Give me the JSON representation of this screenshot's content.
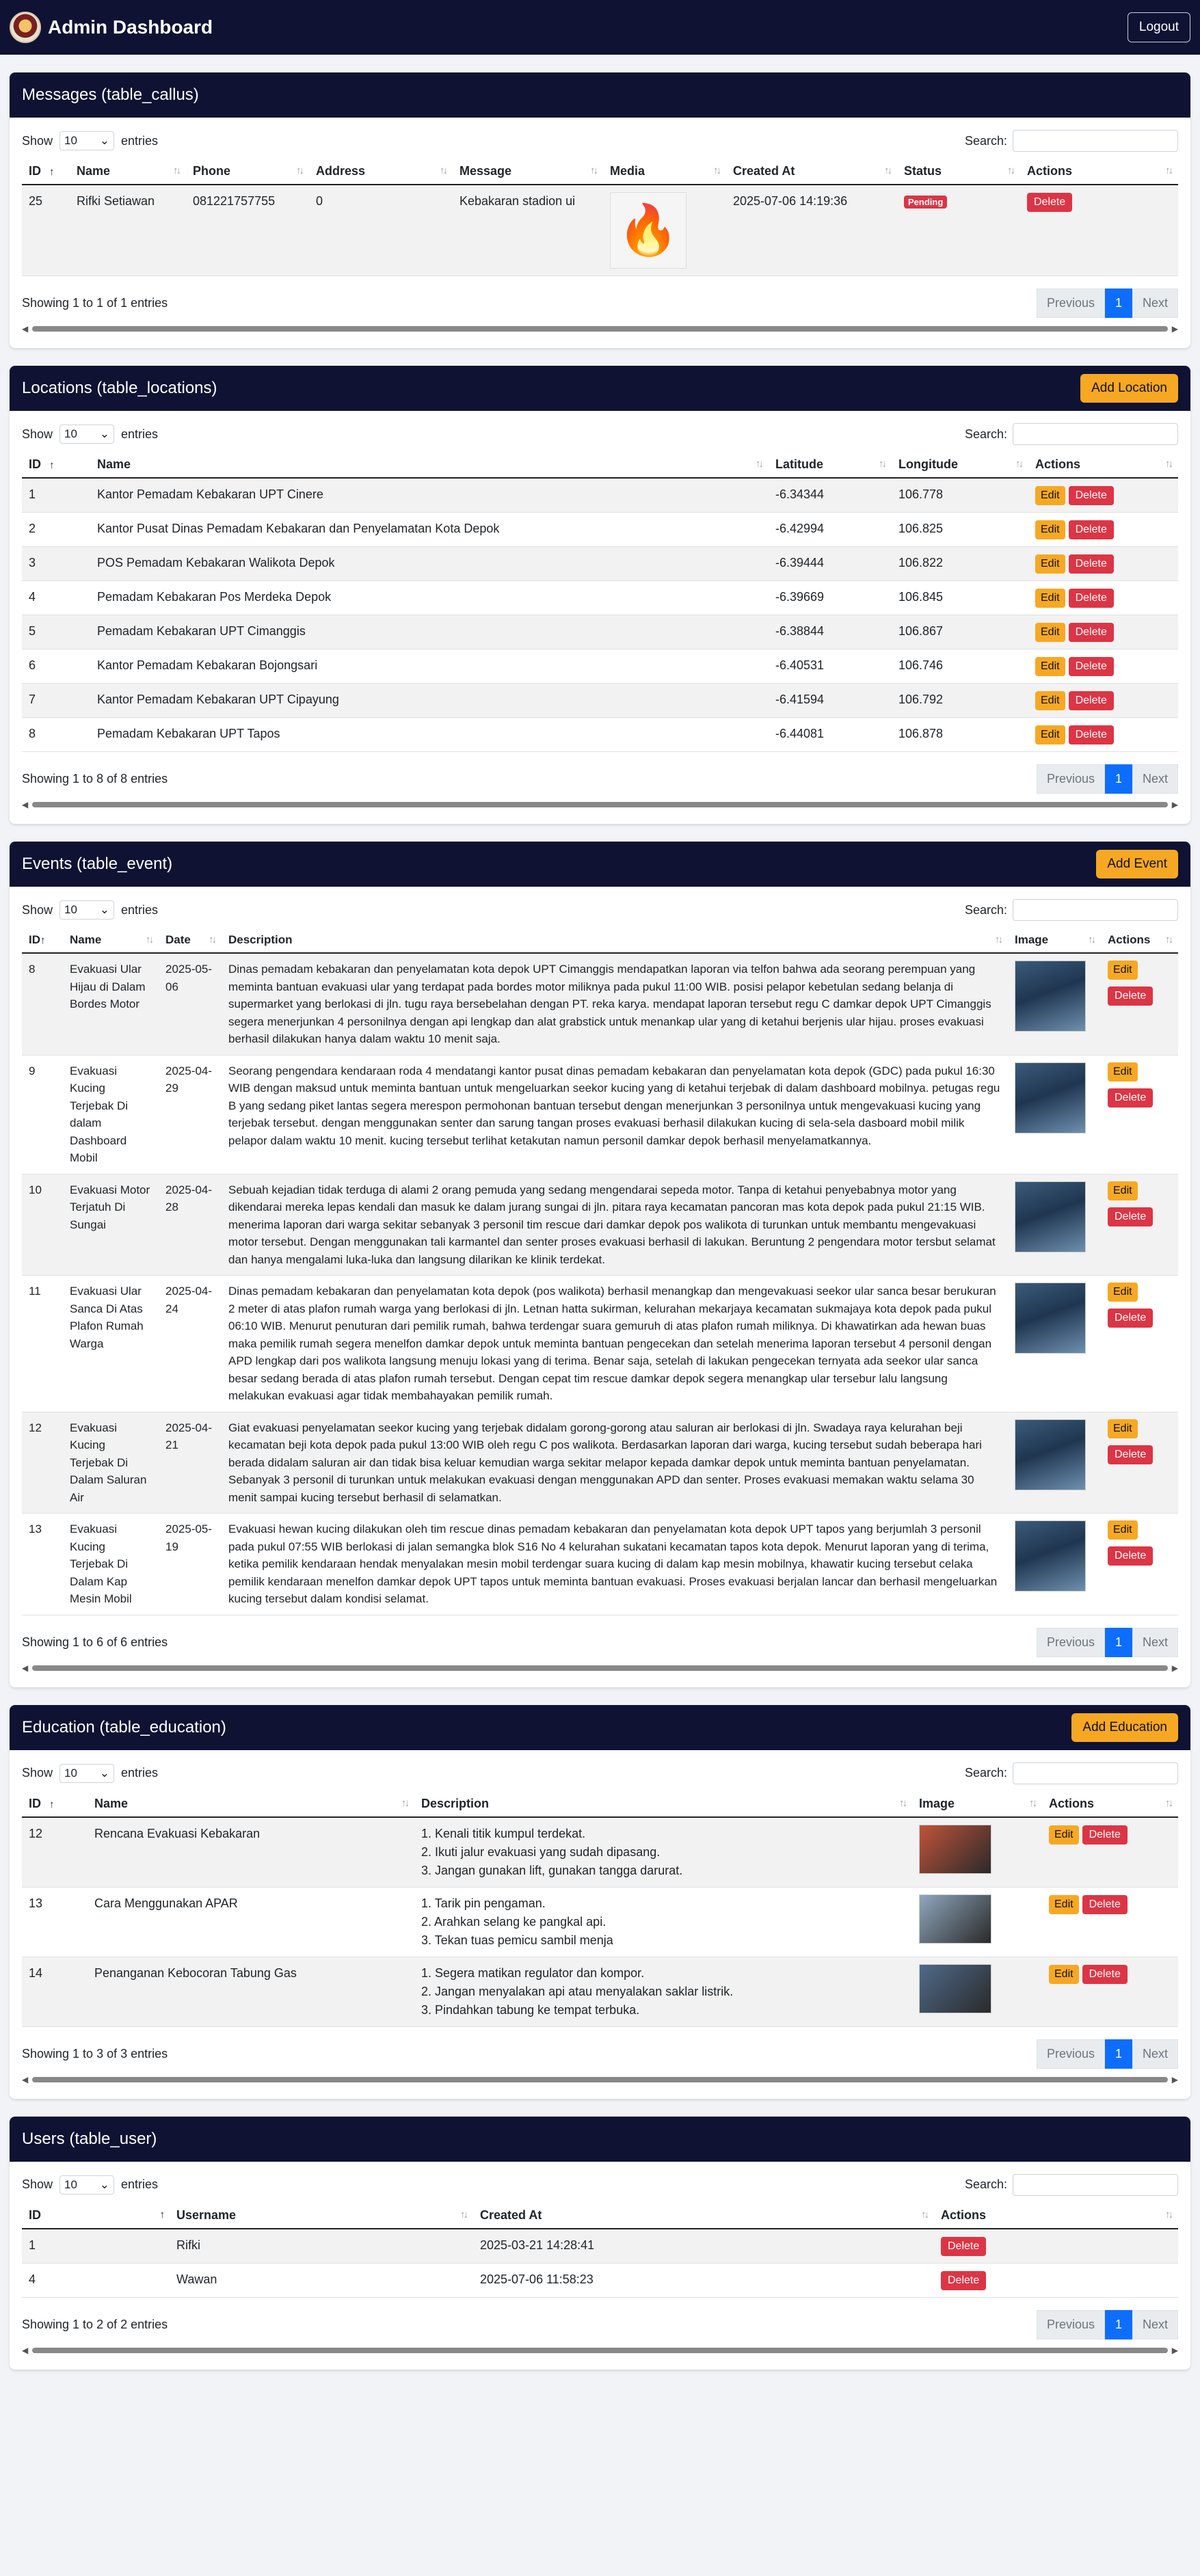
{
  "header": {
    "title": "Admin Dashboard",
    "logout": "Logout"
  },
  "common": {
    "show": "Show",
    "entries": "entries",
    "search": "Search:",
    "page_len": "10",
    "previous": "Previous",
    "next": "Next",
    "page": "1",
    "edit": "Edit",
    "delete": "Delete"
  },
  "callus": {
    "title": "Messages (table_callus)",
    "columns": [
      "ID",
      "Name",
      "Phone",
      "Address",
      "Message",
      "Media",
      "Created At",
      "Status",
      "Actions"
    ],
    "rows": [
      {
        "id": "25",
        "name": "Rifki Setiawan",
        "phone": "081221757755",
        "address": "0",
        "message": "Kebakaran stadion ui",
        "media_icon": "fire-icon",
        "created_at": "2025-07-06 14:19:36",
        "status": "Pending"
      }
    ],
    "info": "Showing 1 to 1 of 1 entries"
  },
  "locations": {
    "title": "Locations (table_locations)",
    "add": "Add Location",
    "columns": [
      "ID",
      "Name",
      "Latitude",
      "Longitude",
      "Actions"
    ],
    "rows": [
      {
        "id": "1",
        "name": "Kantor Pemadam Kebakaran UPT Cinere",
        "lat": "-6.34344",
        "lng": "106.778"
      },
      {
        "id": "2",
        "name": "Kantor Pusat Dinas Pemadam Kebakaran dan Penyelamatan Kota Depok",
        "lat": "-6.42994",
        "lng": "106.825"
      },
      {
        "id": "3",
        "name": "POS Pemadam Kebakaran Walikota Depok",
        "lat": "-6.39444",
        "lng": "106.822"
      },
      {
        "id": "4",
        "name": "Pemadam Kebakaran Pos Merdeka Depok",
        "lat": "-6.39669",
        "lng": "106.845"
      },
      {
        "id": "5",
        "name": "Pemadam Kebakaran UPT Cimanggis",
        "lat": "-6.38844",
        "lng": "106.867"
      },
      {
        "id": "6",
        "name": "Kantor Pemadam Kebakaran Bojongsari",
        "lat": "-6.40531",
        "lng": "106.746"
      },
      {
        "id": "7",
        "name": "Kantor Pemadam Kebakaran UPT Cipayung",
        "lat": "-6.41594",
        "lng": "106.792"
      },
      {
        "id": "8",
        "name": "Pemadam Kebakaran UPT Tapos",
        "lat": "-6.44081",
        "lng": "106.878"
      }
    ],
    "info": "Showing 1 to 8 of 8 entries"
  },
  "events": {
    "title": "Events (table_event)",
    "add": "Add Event",
    "columns": [
      "ID",
      "Name",
      "Date",
      "Description",
      "Image",
      "Actions"
    ],
    "rows": [
      {
        "id": "8",
        "name": "Evakuasi Ular Hijau di Dalam Bordes Motor",
        "date": "2025-05-06",
        "desc": "Dinas pemadam kebakaran dan penyelamatan kota depok UPT Cimanggis mendapatkan laporan via telfon bahwa ada seorang perempuan yang meminta bantuan evakuasi ular yang terdapat pada bordes motor miliknya pada pukul 11:00 WIB. posisi pelapor kebetulan sedang belanja di supermarket yang berlokasi di jln. tugu raya bersebelahan dengan PT. reka karya. mendapat laporan tersebut regu C damkar depok UPT Cimanggis segera menerjunkan 4 personilnya dengan api lengkap dan alat grabstick untuk menankap ular yang di ketahui berjenis ular hijau. proses evakuasi berhasil dilakukan hanya dalam waktu 10 menit saja."
      },
      {
        "id": "9",
        "name": "Evakuasi Kucing Terjebak Di dalam Dashboard Mobil",
        "date": "2025-04-29",
        "desc": "Seorang pengendara kendaraan roda 4 mendatangi kantor pusat dinas pemadam kebakaran dan penyelamatan kota depok (GDC) pada pukul 16:30 WIB dengan maksud untuk meminta bantuan untuk mengeluarkan seekor kucing yang di ketahui terjebak di dalam dashboard mobilnya. petugas regu B yang sedang piket lantas segera merespon permohonan bantuan tersebut dengan menerjunkan 3 personilnya untuk mengevakuasi kucing yang terjebak tersebut. dengan menggunakan senter dan sarung tangan proses evakuasi berhasil dilakukan kucing di sela-sela dasboard mobil milik pelapor dalam waktu 10 menit. kucing tersebut terlihat ketakutan namun personil damkar depok berhasil menyelamatkannya."
      },
      {
        "id": "10",
        "name": "Evakuasi Motor Terjatuh Di Sungai",
        "date": "2025-04-28",
        "desc": "Sebuah kejadian tidak terduga di alami 2 orang pemuda yang sedang mengendarai sepeda motor. Tanpa di ketahui penyebabnya motor yang dikendarai mereka lepas kendali dan masuk ke dalam jurang sungai di jln. pitara raya kecamatan pancoran mas kota depok pada pukul 21:15 WIB. menerima laporan dari warga sekitar sebanyak 3 personil tim rescue dari damkar depok pos walikota di turunkan untuk membantu mengevakuasi motor tersebut. Dengan menggunakan tali karmantel dan senter proses evakuasi berhasil di lakukan. Beruntung 2 pengendara motor tersbut selamat dan hanya mengalami luka-luka dan langsung dilarikan ke klinik terdekat."
      },
      {
        "id": "11",
        "name": "Evakuasi Ular Sanca Di Atas Plafon Rumah Warga",
        "date": "2025-04-24",
        "desc": "Dinas pemadam kebakaran dan penyelamatan kota depok (pos walikota) berhasil menangkap dan mengevakuasi seekor ular sanca besar berukuran 2 meter di atas plafon rumah warga yang berlokasi di jln. Letnan hatta sukirman, kelurahan mekarjaya kecamatan sukmajaya kota depok pada pukul 06:10 WIB. Menurut penuturan dari pemilik rumah, bahwa terdengar suara gemuruh di atas plafon rumah miliknya. Di khawatirkan ada hewan buas maka pemilik rumah segera menelfon damkar depok untuk meminta bantuan pengecekan dan setelah menerima laporan tersebut 4 personil dengan APD lengkap dari pos walikota langsung menuju lokasi yang di terima. Benar saja, setelah di lakukan pengecekan ternyata ada seekor ular sanca besar sedang berada di atas plafon rumah tersebut. Dengan cepat tim rescue damkar depok segera menangkap ular tersebur lalu langsung melakukan evakuasi agar tidak membahayakan pemilik rumah."
      },
      {
        "id": "12",
        "name": "Evakuasi Kucing Terjebak Di Dalam Saluran Air",
        "date": "2025-04-21",
        "desc": "Giat evakuasi penyelamatan seekor kucing yang terjebak didalam gorong-gorong atau saluran air berlokasi di jln. Swadaya raya kelurahan beji kecamatan beji kota depok pada pukul 13:00 WIB oleh regu C pos walikota. Berdasarkan laporan dari warga, kucing tersebut sudah beberapa hari berada didalam saluran air dan tidak bisa keluar kemudian warga sekitar melapor kepada damkar depok untuk meminta bantuan penyelamatan. Sebanyak 3 personil di turunkan untuk melakukan evakuasi dengan menggunakan APD dan senter. Proses evakuasi memakan waktu selama 30 menit sampai kucing tersebut berhasil di selamatkan."
      },
      {
        "id": "13",
        "name": "Evakuasi Kucing Terjebak Di Dalam Kap Mesin Mobil",
        "date": "2025-05-19",
        "desc": "Evakuasi hewan kucing dilakukan oleh tim rescue dinas pemadam kebakaran dan penyelamatan kota depok UPT tapos yang berjumlah 3 personil pada pukul 07:55 WIB berlokasi di jalan semangka blok S16 No 4 kelurahan sukatani kecamatan tapos kota depok. Menurut laporan yang di terima, ketika pemilik kendaraan hendak menyalakan mesin mobil terdengar suara kucing di dalam kap mesin mobilnya, khawatir kucing tersebut celaka pemilik kendaraan menelfon damkar depok UPT tapos untuk meminta bantuan evakuasi. Proses evakuasi berjalan lancar dan berhasil mengeluarkan kucing tersebut dalam kondisi selamat."
      }
    ],
    "info": "Showing 1 to 6 of 6 entries"
  },
  "education": {
    "title": "Education (table_education)",
    "add": "Add Education",
    "columns": [
      "ID",
      "Name",
      "Description",
      "Image",
      "Actions"
    ],
    "rows": [
      {
        "id": "12",
        "name": "Rencana Evakuasi Kebakaran",
        "lines": [
          "1. Kenali titik kumpul terdekat.",
          "2. Ikuti jalur evakuasi yang sudah dipasang.",
          "3. Jangan gunakan lift, gunakan tangga darurat."
        ],
        "img_color": "#c0533a"
      },
      {
        "id": "13",
        "name": "Cara Menggunakan APAR",
        "lines": [
          "1. Tarik pin pengaman.",
          "2. Arahkan selang ke pangkal api.",
          "3. Tekan tuas pemicu sambil menja"
        ],
        "img_color": "#8fa7bd"
      },
      {
        "id": "14",
        "name": "Penanganan Kebocoran Tabung Gas",
        "lines": [
          "1. Segera matikan regulator dan kompor.",
          "2. Jangan menyalakan api atau menyalakan saklar listrik.",
          "3. Pindahkan tabung ke tempat terbuka."
        ],
        "img_color": "#4f6a8a"
      }
    ],
    "info": "Showing 1 to 3 of 3 entries"
  },
  "users": {
    "title": "Users (table_user)",
    "columns": [
      "ID",
      "Username",
      "Created At",
      "Actions"
    ],
    "rows": [
      {
        "id": "1",
        "username": "Rifki",
        "created_at": "2025-03-21 14:28:41"
      },
      {
        "id": "4",
        "username": "Wawan",
        "created_at": "2025-07-06 11:58:23"
      }
    ],
    "info": "Showing 1 to 2 of 2 entries"
  }
}
